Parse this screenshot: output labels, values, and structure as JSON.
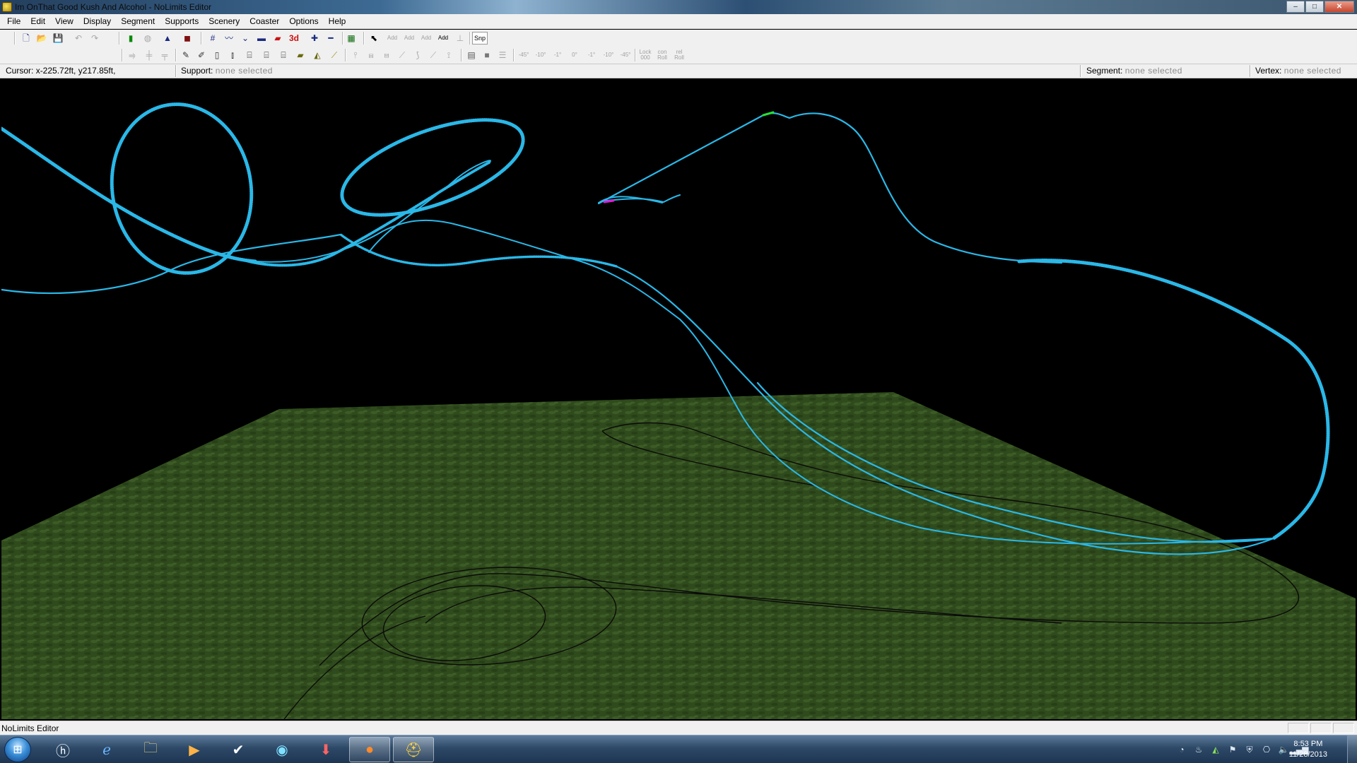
{
  "window": {
    "title": "Im OnThat Good Kush And Alcohol - NoLimits Editor",
    "controls": {
      "minimize": "–",
      "maximize": "□",
      "close": "✕"
    }
  },
  "menu": [
    "File",
    "Edit",
    "View",
    "Display",
    "Segment",
    "Supports",
    "Scenery",
    "Coaster",
    "Options",
    "Help"
  ],
  "toolbar": {
    "label_3d": "3d",
    "label_snap": "Snp",
    "add_labels": [
      "Add",
      "Add",
      "Add",
      "Add"
    ],
    "angle_labels": [
      "-45°",
      "-10°",
      "-1°",
      "0°",
      "-1°",
      "-10°",
      "-45°"
    ],
    "roll_labels": [
      {
        "top": "Lock",
        "bottom": "000"
      },
      {
        "top": "con",
        "bottom": "Roll"
      },
      {
        "top": "rel",
        "bottom": "Roll"
      }
    ]
  },
  "info": {
    "cursor_label": "Cursor:",
    "cursor_value": "x-225.72ft, y217.85ft,",
    "support_label": "Support:",
    "support_value": "none selected",
    "segment_label": "Segment:",
    "segment_value": "none selected",
    "vertex_label": "Vertex:",
    "vertex_value": "none selected"
  },
  "viewport": {
    "track_color": "#2ab8e8",
    "ground_color": "#2f4a1c",
    "shadow_color": "#0a0a0a"
  },
  "status": {
    "text": "NoLimits Editor"
  },
  "taskbar": {
    "clock_time": "8:53 PM",
    "clock_date": "11/28/2013"
  }
}
